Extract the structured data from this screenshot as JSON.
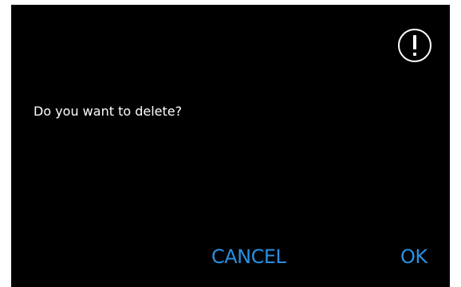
{
  "dialog": {
    "icon": "exclamation-circle-icon",
    "message": "Do you want to delete?",
    "buttons": {
      "cancel_label": "CANCEL",
      "ok_label": "OK"
    }
  },
  "colors": {
    "background": "#000000",
    "text": "#ffffff",
    "accent": "#2a8fe0"
  }
}
